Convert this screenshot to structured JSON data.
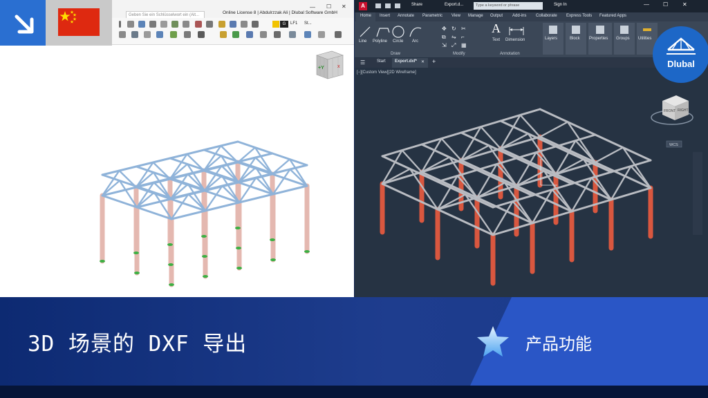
{
  "left_app": {
    "search_placeholder": "Geben Sie ein Schlüsselwort ein (Alt...",
    "window_title": "Online License 8 | Abdulrzzak Ali | Dlubal Software GmbH",
    "toolbar": {
      "g_label": "G",
      "lf_label": "LF1",
      "st_label": "St..."
    },
    "navcube_axis": "+Y"
  },
  "right_app": {
    "search_placeholder": "Type a keyword or phrase",
    "share_label": "Share",
    "doc_title": "Export.d...",
    "sign_in": "Sign In",
    "menu_tabs": [
      "Home",
      "Insert",
      "Annotate",
      "Parametric",
      "View",
      "Manage",
      "Output",
      "Add-ins",
      "Collaborate",
      "Express Tools",
      "Featured Apps"
    ],
    "ribbon": {
      "draw_tools": [
        "Line",
        "Polyline",
        "Circle",
        "Arc"
      ],
      "text": "Text",
      "dimension": "Dimension",
      "panels": [
        "Layers",
        "Block",
        "Properties",
        "Groups",
        "Utilities"
      ],
      "groups": {
        "draw": "Draw",
        "modify": "Modify",
        "annotation": "Annotation"
      }
    },
    "doc_tabs": {
      "start": "Start",
      "file": "Export.dxf*"
    },
    "view_label": "[−][Custom View][2D Wireframe]",
    "viewcube": {
      "front": "FRONT",
      "right": "RIGHT",
      "wcs": "WCS"
    }
  },
  "brand": {
    "name": "Dlubal"
  },
  "banner": {
    "headline": "3D 场景的 DXF 导出",
    "feature": "产品功能"
  },
  "colors": {
    "accent_blue": "#2a6fd1",
    "banner_dark": "#0d2a72",
    "column_red": "#d9573f",
    "truss_blue": "#8fb3d9",
    "autocad_bg": "#263343"
  },
  "icons": [
    "download-arrow-icon",
    "china-flag-icon",
    "dlubal-logo-icon",
    "star-icon",
    "hamburger-icon",
    "plus-icon"
  ]
}
